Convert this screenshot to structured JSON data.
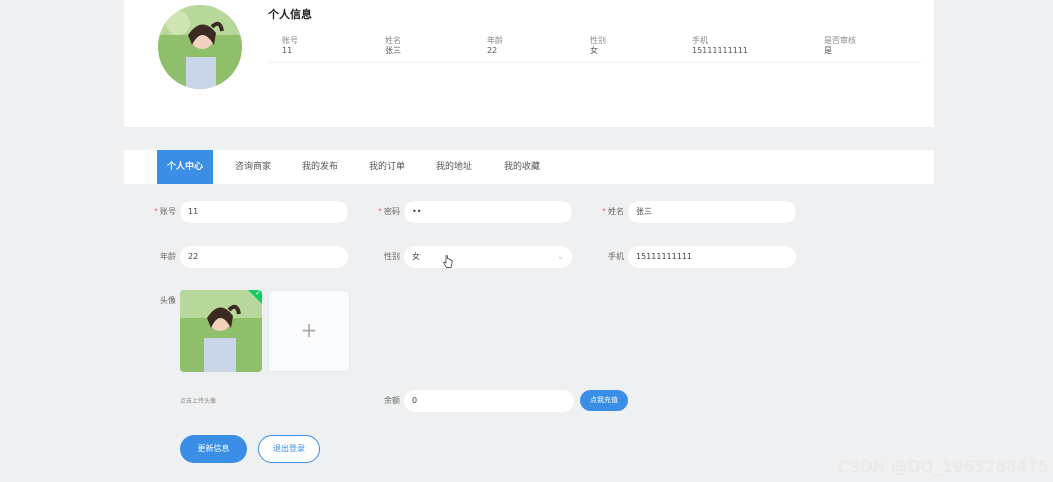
{
  "profile": {
    "title": "个人信息",
    "columns": [
      {
        "header": "账号",
        "value": "11"
      },
      {
        "header": "姓名",
        "value": "张三"
      },
      {
        "header": "年龄",
        "value": "22"
      },
      {
        "header": "性别",
        "value": "女"
      },
      {
        "header": "手机",
        "value": "15111111111"
      },
      {
        "header": "是否审核",
        "value": "是"
      }
    ]
  },
  "tabs": [
    "个人中心",
    "咨询商家",
    "我的发布",
    "我的订单",
    "我的地址",
    "我的收藏"
  ],
  "form": {
    "account": {
      "label": "账号",
      "value": "11"
    },
    "password": {
      "label": "密码",
      "value": "••"
    },
    "name": {
      "label": "姓名",
      "value": "张三"
    },
    "age": {
      "label": "年龄",
      "value": "22"
    },
    "gender": {
      "label": "性别",
      "value": "女"
    },
    "phone": {
      "label": "手机",
      "value": "15111111111"
    },
    "avatar_label": "头像",
    "upload_hint": "点击上传头像",
    "balance": {
      "label": "余额",
      "value": "0"
    },
    "recharge_label": "点我充值",
    "update_label": "更新信息",
    "logout_label": "退出登录"
  },
  "watermark": "CSDN @QQ_1963288475",
  "colors": {
    "accent": "#3a8ee6",
    "required": "#f56c6c",
    "success": "#13ce66"
  }
}
